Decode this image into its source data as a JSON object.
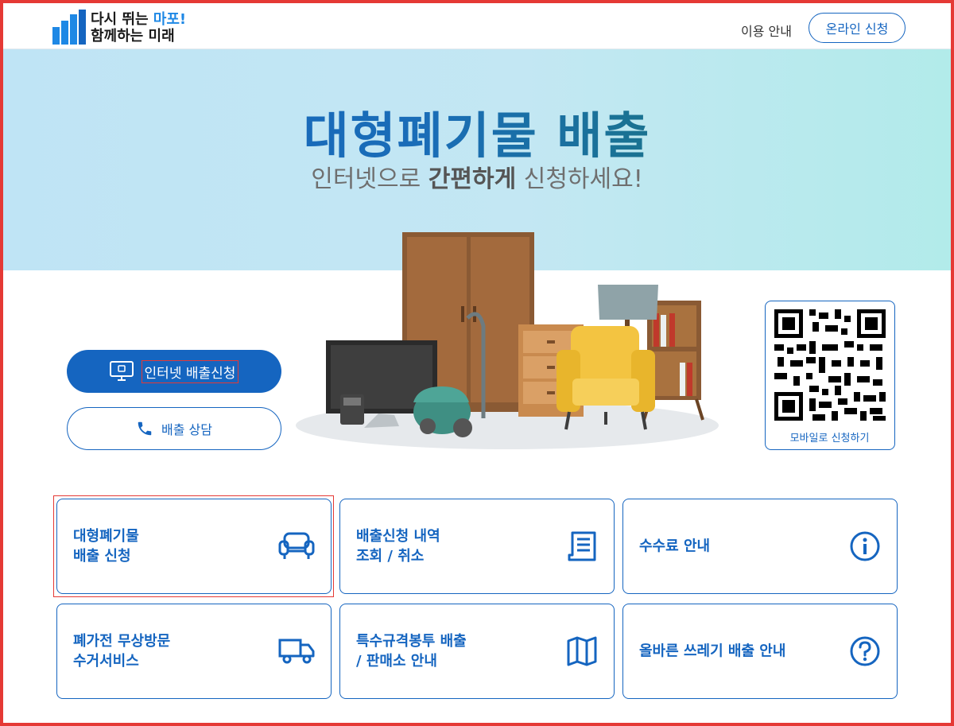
{
  "header": {
    "logo_line1_a": "다시 뛰는 ",
    "logo_line1_b": "마포!",
    "logo_line2": "함께하는 미래",
    "nav_guide": "이용 안내",
    "nav_apply": "온라인 신청"
  },
  "hero": {
    "title": "대형폐기물 배출",
    "sub_a": "인터넷으로 ",
    "sub_b": "간편하게",
    "sub_c": " 신청하세요!"
  },
  "actions": {
    "internet_apply": "인터넷 배출신청",
    "consult": "배출 상담"
  },
  "qr": {
    "label": "모바일로 신청하기"
  },
  "cards": [
    {
      "label": "대형폐기물\n배출 신청",
      "icon": "sofa-icon"
    },
    {
      "label": "배출신청 내역\n조회 / 취소",
      "icon": "receipt-icon"
    },
    {
      "label": "수수료 안내",
      "icon": "info-icon"
    },
    {
      "label": "폐가전 무상방문\n수거서비스",
      "icon": "truck-icon"
    },
    {
      "label": "특수규격봉투 배출\n/ 판매소 안내",
      "icon": "map-icon"
    },
    {
      "label": "올바른 쓰레기 배출 안내",
      "icon": "help-icon"
    }
  ],
  "colors": {
    "primary": "#1565c0",
    "accent": "#1e88e5",
    "highlight": "#e53935"
  }
}
